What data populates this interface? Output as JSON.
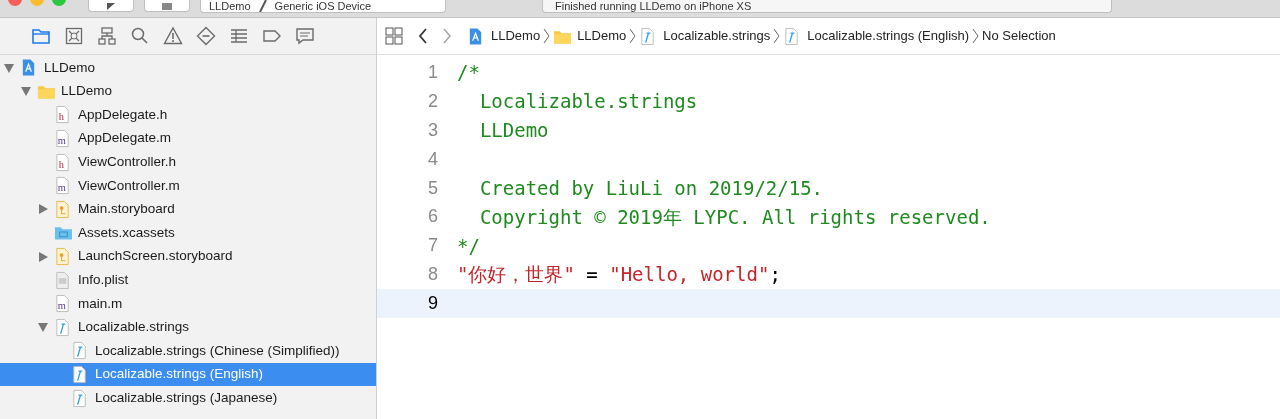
{
  "toolbar": {
    "scheme": {
      "project": "LLDemo",
      "device": "Generic iOS Device"
    },
    "status": "Finished running LLDemo on iPhone XS"
  },
  "navigator_tabs": [
    {
      "kind": "folder",
      "selected": true
    },
    {
      "kind": "xbox",
      "selected": false
    },
    {
      "kind": "hierarchy",
      "selected": false
    },
    {
      "kind": "search",
      "selected": false
    },
    {
      "kind": "warning",
      "selected": false
    },
    {
      "kind": "diamond",
      "selected": false
    },
    {
      "kind": "list",
      "selected": false
    },
    {
      "kind": "tag",
      "selected": false
    },
    {
      "kind": "bubble",
      "selected": false
    }
  ],
  "tree": [
    {
      "label": "LLDemo",
      "kind": "project",
      "expanded": true,
      "selected": false,
      "children": [
        {
          "label": "LLDemo",
          "kind": "folder",
          "expanded": true,
          "selected": false,
          "children": [
            {
              "label": "AppDelegate.h",
              "kind": "h",
              "selected": false
            },
            {
              "label": "AppDelegate.m",
              "kind": "m",
              "selected": false
            },
            {
              "label": "ViewController.h",
              "kind": "h",
              "selected": false
            },
            {
              "label": "ViewController.m",
              "kind": "m",
              "selected": false
            },
            {
              "label": "Main.storyboard",
              "kind": "storyboard",
              "expanded": false,
              "selected": false
            },
            {
              "label": "Assets.xcassets",
              "kind": "assets",
              "selected": false
            },
            {
              "label": "LaunchScreen.storyboard",
              "kind": "storyboard",
              "expanded": false,
              "selected": false
            },
            {
              "label": "Info.plist",
              "kind": "plist",
              "selected": false
            },
            {
              "label": "main.m",
              "kind": "m",
              "selected": false
            },
            {
              "label": "Localizable.strings",
              "kind": "strings",
              "expanded": true,
              "selected": false,
              "children": [
                {
                  "label": "Localizable.strings (Chinese (Simplified))",
                  "kind": "strings",
                  "selected": false
                },
                {
                  "label": "Localizable.strings (English)",
                  "kind": "strings",
                  "selected": true
                },
                {
                  "label": "Localizable.strings (Japanese)",
                  "kind": "strings",
                  "selected": false
                }
              ]
            }
          ]
        }
      ]
    }
  ],
  "jump_bar": [
    {
      "label": "LLDemo",
      "kind": "project"
    },
    {
      "label": "LLDemo",
      "kind": "folder"
    },
    {
      "label": "Localizable.strings",
      "kind": "strings"
    },
    {
      "label": "Localizable.strings (English)",
      "kind": "strings"
    },
    {
      "label": "No Selection",
      "kind": "none"
    }
  ],
  "code_lines": [
    {
      "number": "1",
      "current": false,
      "segments": [
        {
          "kind": "comment",
          "text": "/*"
        }
      ]
    },
    {
      "number": "2",
      "current": false,
      "segments": [
        {
          "kind": "comment",
          "text": "  Localizable.strings"
        }
      ]
    },
    {
      "number": "3",
      "current": false,
      "segments": [
        {
          "kind": "comment",
          "text": "  LLDemo"
        }
      ]
    },
    {
      "number": "4",
      "current": false
    },
    {
      "number": "5",
      "current": false,
      "segments": [
        {
          "kind": "comment",
          "text": "  Created by LiuLi on 2019/2/15."
        }
      ]
    },
    {
      "number": "6",
      "current": false,
      "segments": [
        {
          "kind": "comment",
          "text": "  Copyright © 2019年 LYPC. All rights reserved."
        }
      ]
    },
    {
      "number": "7",
      "current": false,
      "segments": [
        {
          "kind": "comment",
          "text": "*/"
        }
      ]
    },
    {
      "number": "8",
      "current": false,
      "segments": [
        {
          "kind": "string",
          "text": "\"你好，世界\""
        },
        {
          "kind": "plain",
          "text": " = "
        },
        {
          "kind": "string",
          "text": "\"Hello, world\""
        },
        {
          "kind": "plain",
          "text": ";"
        }
      ]
    },
    {
      "number": "9",
      "current": true
    }
  ]
}
